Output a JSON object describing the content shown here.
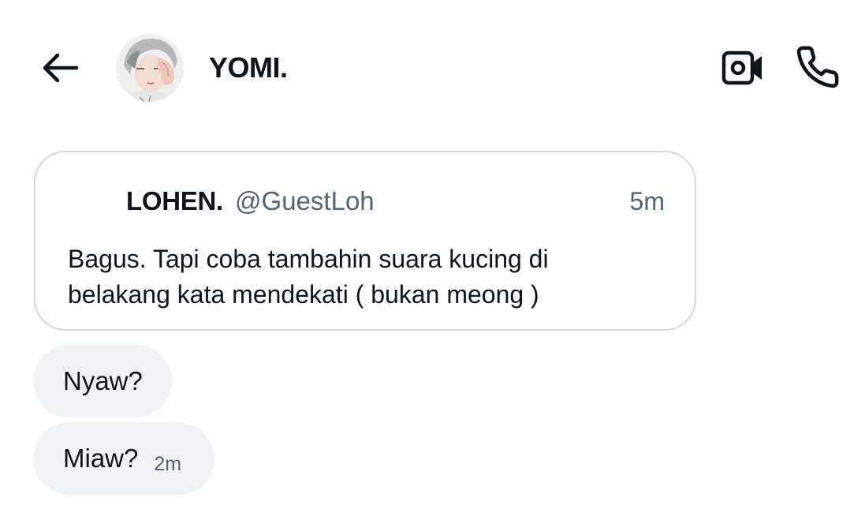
{
  "header": {
    "title": "YOMI.",
    "back_icon": "arrow-left-icon",
    "video_icon": "video-camera-icon",
    "phone_icon": "phone-icon"
  },
  "quote": {
    "name": "LOHEN.",
    "handle": "@GuestLoh",
    "time": "5m",
    "text": "Bagus. Tapi coba tambahin suara kucing di belakang kata mendekati ( bukan meong )"
  },
  "messages": [
    {
      "text": "Nyaw?"
    },
    {
      "text": "Miaw?",
      "time": "2m"
    }
  ],
  "colors": {
    "text": "#0f1419",
    "secondary": "#536471",
    "bubble": "#eff3f4",
    "border": "#cfd9de"
  }
}
